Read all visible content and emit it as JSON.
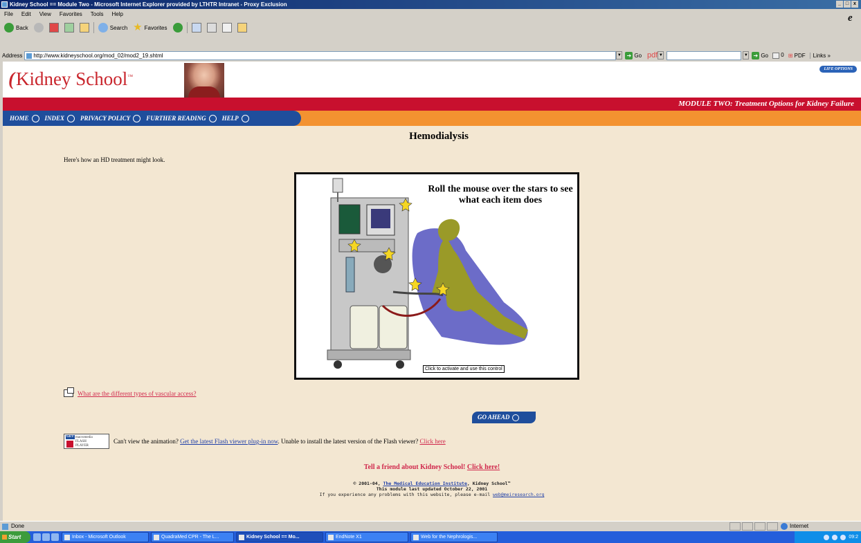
{
  "window": {
    "title": "Kidney School == Module Two - Microsoft Internet Explorer provided by LTHTR Intranet - Proxy Exclusion",
    "buttons": [
      "_",
      "□",
      "x"
    ]
  },
  "menubar": {
    "items": [
      "File",
      "Edit",
      "View",
      "Favorites",
      "Tools",
      "Help"
    ]
  },
  "toolbar": {
    "back_label": "Back",
    "search_label": "Search",
    "favorites_label": "Favorites"
  },
  "addressbar": {
    "label": "Address",
    "url": "http://www.kidneyschool.org/mod_02/mod2_19.shtml",
    "go_label": "Go",
    "pdf_label": "pdf",
    "go2_label": "Go",
    "counter": "0",
    "pdf2_label": "PDF",
    "links_label": "Links"
  },
  "site": {
    "logo": "Kidney School",
    "logo_mark": "™",
    "life_options": "LIFE OPTIONS",
    "module_banner": "MODULE TWO: Treatment Options for Kidney Failure",
    "nav": [
      "HOME",
      "INDEX",
      "PRIVACY POLICY",
      "FURTHER READING",
      "HELP"
    ]
  },
  "content": {
    "title": "Hemodialysis",
    "intro": "Here's how an HD treatment might look.",
    "flash_caption": "Roll the mouse over the stars to see what each item does",
    "activate_label": "Click to activate and use this control",
    "vascular_link": "What are the different types of vascular access?",
    "go_ahead": "GO AHEAD",
    "flash_badge": {
      "get": "GET",
      "line1": "macromedia",
      "line2": "FLASH",
      "line3": "PLAYER"
    },
    "flash_q": "Can't view the animation?",
    "flash_link": "Get the latest Flash viewer plug-in now",
    "flash_mid": ". Unable to install the latest version of the Flash viewer?",
    "flash_click": "Click here",
    "tell_friend": "Tell a friend about Kidney School!",
    "tell_click": "Click here!",
    "footer_copy": "© 2001-04,",
    "footer_mei": "The Medical Education Institute",
    "footer_ks": ", Kidney School™",
    "footer_updated": "This module last updated October 22, 2001",
    "footer_problem": "If you experience any problems with this website, please e-mail",
    "footer_email": "web@meiresearch.org"
  },
  "status": {
    "text": "Done",
    "zone": "Internet"
  },
  "taskbar": {
    "start": "Start",
    "tasks": [
      {
        "label": "Inbox - Microsoft Outlook",
        "active": false
      },
      {
        "label": "QuadraMed CPR - The L...",
        "active": false
      },
      {
        "label": "Kidney School == Mo...",
        "active": true
      },
      {
        "label": "EndNote X1",
        "active": false
      },
      {
        "label": "Web for the Nephrologis...",
        "active": false
      }
    ],
    "clock": "09:2"
  },
  "colors": {
    "brand_red": "#c8102e",
    "nav_blue": "#1f4e9c",
    "nav_orange": "#f39230",
    "page_bg": "#f3e7d2"
  }
}
